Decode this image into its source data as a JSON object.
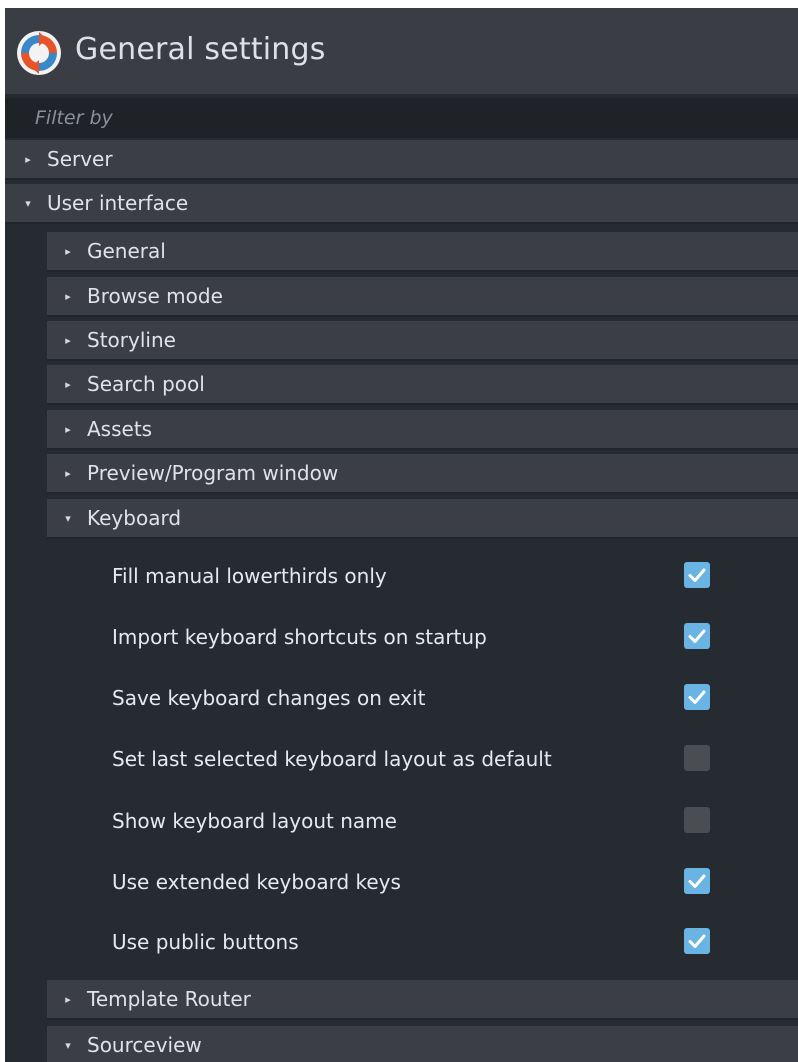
{
  "window": {
    "title": "General settings",
    "logo_icon": "refresh-logo-icon",
    "colors": {
      "logo_orange": "#e8542a",
      "logo_blue": "#3b88c8",
      "checkbox_checked": "#6ab4e3",
      "checkbox_unchecked": "#4a4d52"
    }
  },
  "filter": {
    "placeholder": "Filter by",
    "value": ""
  },
  "tree": {
    "server": {
      "label": "Server",
      "expanded": false
    },
    "user_interface": {
      "label": "User interface",
      "expanded": true,
      "children": {
        "general": {
          "label": "General",
          "expanded": false
        },
        "browse_mode": {
          "label": "Browse mode",
          "expanded": false
        },
        "storyline": {
          "label": "Storyline",
          "expanded": false
        },
        "search_pool": {
          "label": "Search pool",
          "expanded": false
        },
        "assets": {
          "label": "Assets",
          "expanded": false
        },
        "preview_program": {
          "label": "Preview/Program window",
          "expanded": false
        },
        "keyboard": {
          "label": "Keyboard",
          "expanded": true,
          "options": [
            {
              "label": "Fill manual lowerthirds only",
              "checked": true
            },
            {
              "label": "Import keyboard shortcuts on startup",
              "checked": true
            },
            {
              "label": "Save keyboard changes on exit",
              "checked": true
            },
            {
              "label": "Set last selected keyboard layout as default",
              "checked": false
            },
            {
              "label": "Show keyboard layout name",
              "checked": false
            },
            {
              "label": "Use extended keyboard keys",
              "checked": true
            },
            {
              "label": "Use public buttons",
              "checked": true
            }
          ]
        },
        "template_router": {
          "label": "Template Router",
          "expanded": false
        },
        "sourceview": {
          "label": "Sourceview",
          "expanded": true
        }
      }
    }
  },
  "icons": {
    "collapsed": "▸",
    "expanded": "▾"
  }
}
